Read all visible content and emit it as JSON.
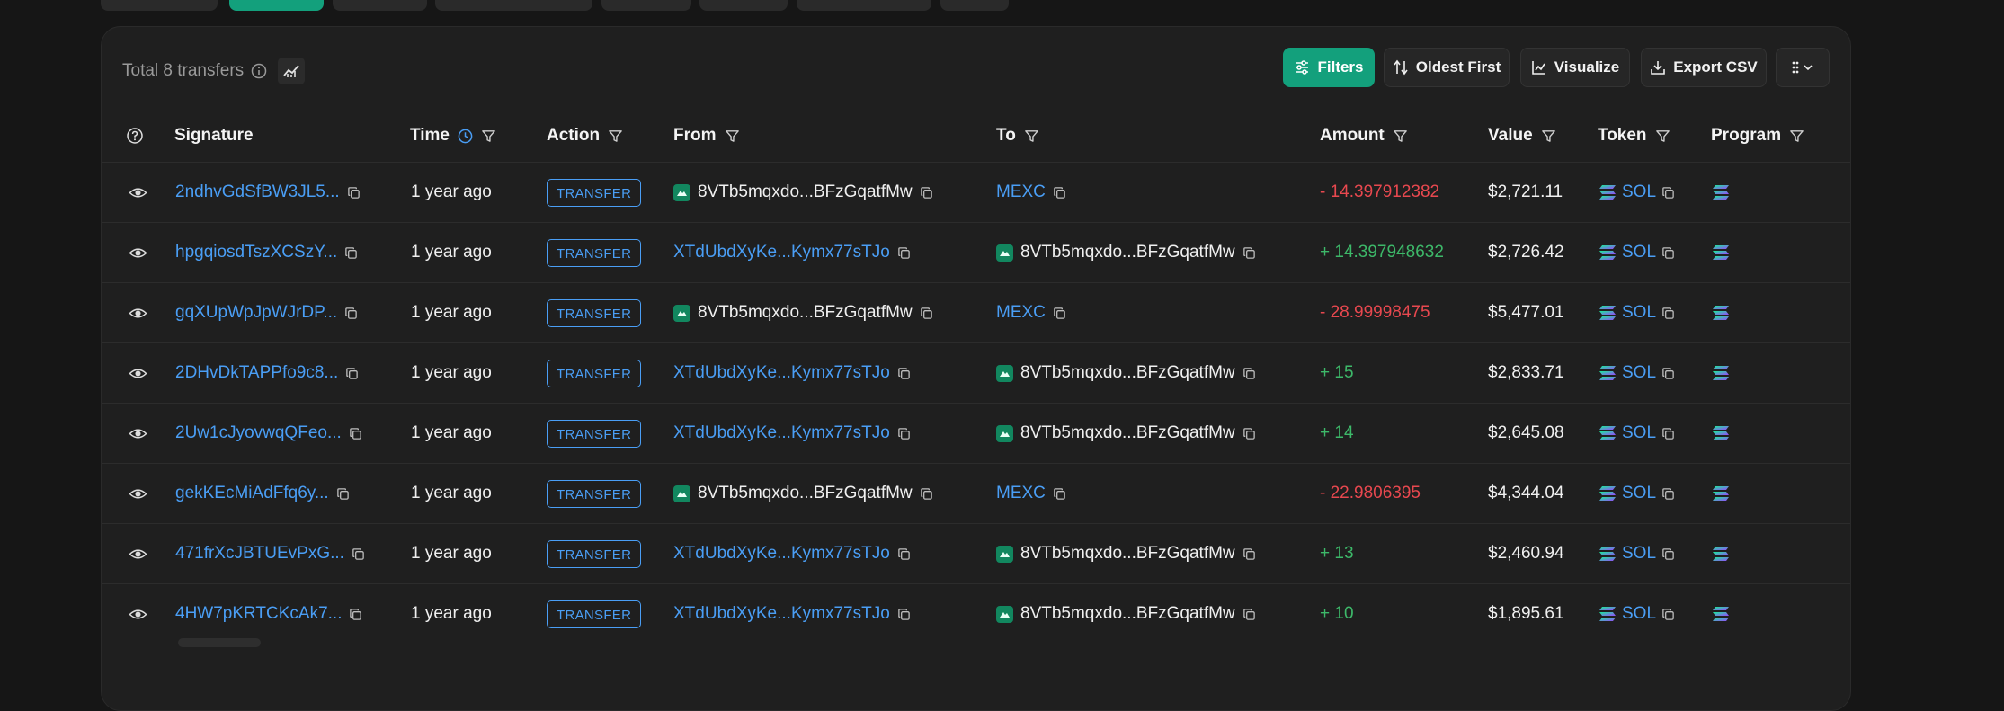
{
  "summary": {
    "total_label": "Total 8 transfers"
  },
  "toolbar": {
    "filters_label": "Filters",
    "sort_label": "Oldest First",
    "visualize_label": "Visualize",
    "export_label": "Export CSV"
  },
  "columns": {
    "signature": "Signature",
    "time": "Time",
    "action": "Action",
    "from": "From",
    "to": "To",
    "amount": "Amount",
    "value": "Value",
    "token": "Token",
    "program": "Program"
  },
  "rows": [
    {
      "signature": "2ndhvGdSfBW3JL5...",
      "time": "1 year ago",
      "action": "TRANSFER",
      "from": "8VTb5mqxdo...BFzGqatfMw",
      "from_type": "wallet",
      "to": "MEXC",
      "to_type": "link",
      "amount": "- 14.397912382",
      "sign": "neg",
      "value": "$2,721.11",
      "token": "SOL"
    },
    {
      "signature": "hpgqiosdTszXCSzY...",
      "time": "1 year ago",
      "action": "TRANSFER",
      "from": "XTdUbdXyKe...Kymx77sTJo",
      "from_type": "link",
      "to": "8VTb5mqxdo...BFzGqatfMw",
      "to_type": "wallet",
      "amount": "+ 14.397948632",
      "sign": "pos",
      "value": "$2,726.42",
      "token": "SOL"
    },
    {
      "signature": "gqXUpWpJpWJrDP...",
      "time": "1 year ago",
      "action": "TRANSFER",
      "from": "8VTb5mqxdo...BFzGqatfMw",
      "from_type": "wallet",
      "to": "MEXC",
      "to_type": "link",
      "amount": "- 28.99998475",
      "sign": "neg",
      "value": "$5,477.01",
      "token": "SOL"
    },
    {
      "signature": "2DHvDkTAPPfo9c8...",
      "time": "1 year ago",
      "action": "TRANSFER",
      "from": "XTdUbdXyKe...Kymx77sTJo",
      "from_type": "link",
      "to": "8VTb5mqxdo...BFzGqatfMw",
      "to_type": "wallet",
      "amount": "+ 15",
      "sign": "pos",
      "value": "$2,833.71",
      "token": "SOL"
    },
    {
      "signature": "2Uw1cJyovwqQFeo...",
      "time": "1 year ago",
      "action": "TRANSFER",
      "from": "XTdUbdXyKe...Kymx77sTJo",
      "from_type": "link",
      "to": "8VTb5mqxdo...BFzGqatfMw",
      "to_type": "wallet",
      "amount": "+ 14",
      "sign": "pos",
      "value": "$2,645.08",
      "token": "SOL"
    },
    {
      "signature": "gekKEcMiAdFfq6y...",
      "time": "1 year ago",
      "action": "TRANSFER",
      "from": "8VTb5mqxdo...BFzGqatfMw",
      "from_type": "wallet",
      "to": "MEXC",
      "to_type": "link",
      "amount": "- 22.9806395",
      "sign": "neg",
      "value": "$4,344.04",
      "token": "SOL"
    },
    {
      "signature": "471frXcJBTUEvPxG...",
      "time": "1 year ago",
      "action": "TRANSFER",
      "from": "XTdUbdXyKe...Kymx77sTJo",
      "from_type": "link",
      "to": "8VTb5mqxdo...BFzGqatfMw",
      "to_type": "wallet",
      "amount": "+ 13",
      "sign": "pos",
      "value": "$2,460.94",
      "token": "SOL"
    },
    {
      "signature": "4HW7pKRTCKcAk7...",
      "time": "1 year ago",
      "action": "TRANSFER",
      "from": "XTdUbdXyKe...Kymx77sTJo",
      "from_type": "link",
      "to": "8VTb5mqxdo...BFzGqatfMw",
      "to_type": "wallet",
      "amount": "+ 10",
      "sign": "pos",
      "value": "$1,895.61",
      "token": "SOL"
    }
  ],
  "colors": {
    "accent": "#13a07c",
    "link": "#4a9ef5",
    "negative": "#e8484f",
    "positive": "#3db869",
    "background": "#161616",
    "panel": "#1f1f1f"
  }
}
